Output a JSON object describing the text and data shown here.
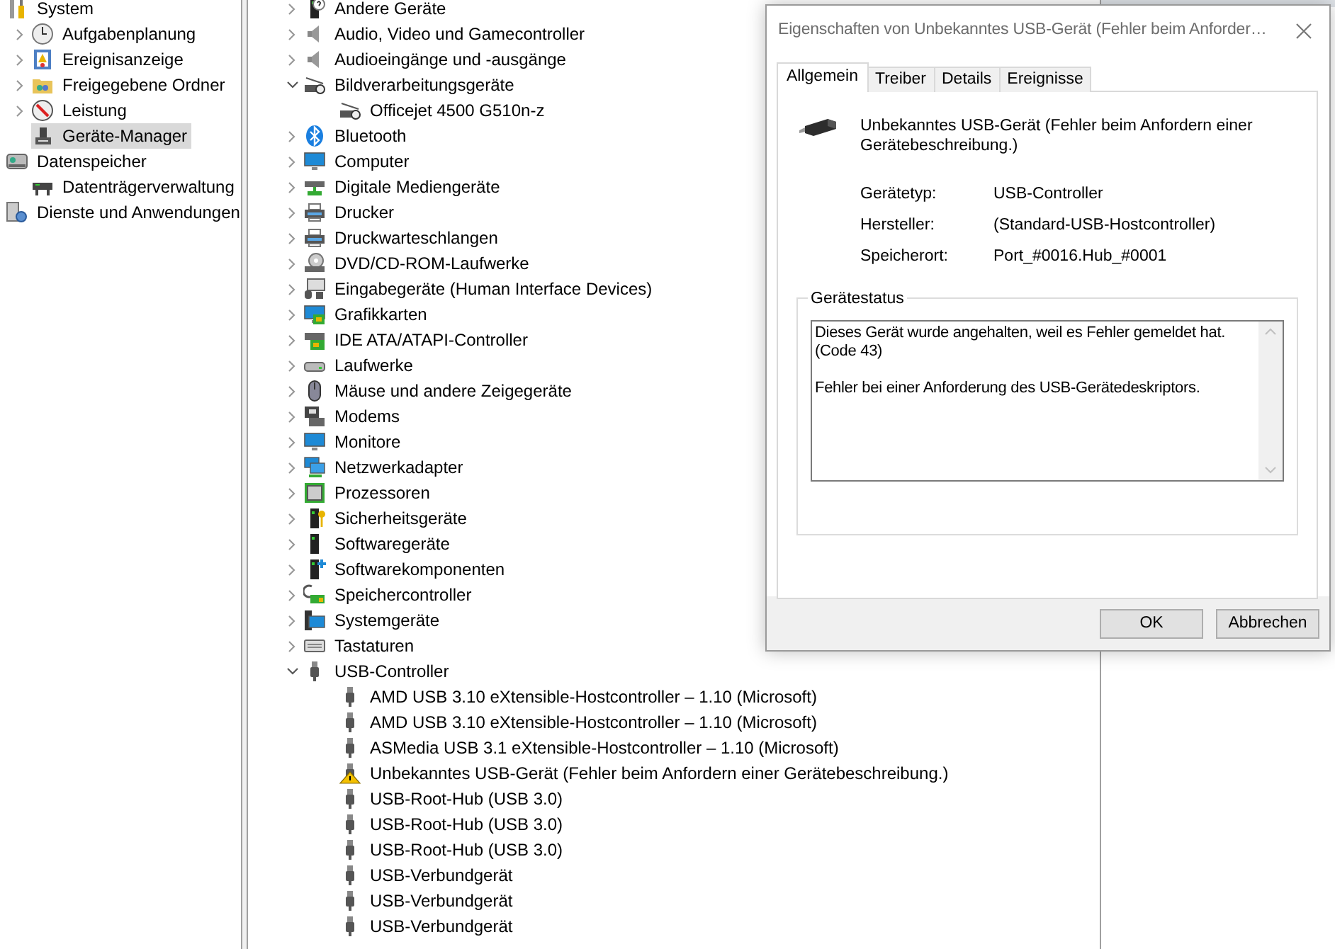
{
  "left_tree": [
    {
      "label": "System",
      "kind": "tools",
      "selected": false,
      "children": [
        {
          "label": "Aufgabenplanung",
          "kind": "clock",
          "expanded": false,
          "selected": false
        },
        {
          "label": "Ereignisanzeige",
          "kind": "event-log",
          "expanded": false,
          "selected": false
        },
        {
          "label": "Freigegebene Ordner",
          "kind": "shared-folder",
          "expanded": false,
          "selected": false
        },
        {
          "label": "Leistung",
          "kind": "performance",
          "expanded": false,
          "selected": false
        },
        {
          "label": "Geräte-Manager",
          "kind": "device-manager",
          "selected": true
        }
      ]
    },
    {
      "label": "Datenspeicher",
      "kind": "storage",
      "selected": false,
      "children": [
        {
          "label": "Datenträgerverwaltung",
          "kind": "disk",
          "selected": false
        }
      ]
    },
    {
      "label": "Dienste und Anwendungen",
      "kind": "services",
      "selected": false
    }
  ],
  "device_tree": [
    {
      "label": "Andere Geräte",
      "kind": "unknown",
      "expanded": false,
      "selected": false
    },
    {
      "label": "Audio, Video und Gamecontroller",
      "kind": "speaker",
      "expanded": false,
      "selected": false
    },
    {
      "label": "Audioeingänge und -ausgänge",
      "kind": "speaker",
      "expanded": false,
      "selected": false
    },
    {
      "label": "Bildverarbeitungsgeräte",
      "kind": "camera",
      "expanded": true,
      "selected": false,
      "children": [
        {
          "label": "Officejet 4500 G510n-z",
          "kind": "camera",
          "selected": false
        }
      ]
    },
    {
      "label": "Bluetooth",
      "kind": "bluetooth",
      "expanded": false,
      "selected": false
    },
    {
      "label": "Computer",
      "kind": "monitor",
      "expanded": false,
      "selected": false
    },
    {
      "label": "Digitale Mediengeräte",
      "kind": "media",
      "expanded": false,
      "selected": false
    },
    {
      "label": "Drucker",
      "kind": "printer",
      "expanded": false,
      "selected": false
    },
    {
      "label": "Druckwarteschlangen",
      "kind": "printer",
      "expanded": false,
      "selected": false
    },
    {
      "label": "DVD/CD-ROM-Laufwerke",
      "kind": "dvd",
      "expanded": false,
      "selected": false
    },
    {
      "label": "Eingabegeräte (Human Interface Devices)",
      "kind": "hid",
      "expanded": false,
      "selected": false
    },
    {
      "label": "Grafikkarten",
      "kind": "graphics",
      "expanded": false,
      "selected": false
    },
    {
      "label": "IDE ATA/ATAPI-Controller",
      "kind": "ide",
      "expanded": false,
      "selected": false
    },
    {
      "label": "Laufwerke",
      "kind": "drive",
      "expanded": false,
      "selected": false
    },
    {
      "label": "Mäuse und andere Zeigegeräte",
      "kind": "mouse",
      "expanded": false,
      "selected": false
    },
    {
      "label": "Modems",
      "kind": "modem",
      "expanded": false,
      "selected": false
    },
    {
      "label": "Monitore",
      "kind": "monitor",
      "expanded": false,
      "selected": false
    },
    {
      "label": "Netzwerkadapter",
      "kind": "network",
      "expanded": false,
      "selected": false
    },
    {
      "label": "Prozessoren",
      "kind": "processor",
      "expanded": false,
      "selected": false
    },
    {
      "label": "Sicherheitsgeräte",
      "kind": "security",
      "expanded": false,
      "selected": false
    },
    {
      "label": "Softwaregeräte",
      "kind": "tower",
      "expanded": false,
      "selected": false
    },
    {
      "label": "Softwarekomponenten",
      "kind": "component",
      "expanded": false,
      "selected": false
    },
    {
      "label": "Speichercontroller",
      "kind": "controller",
      "expanded": false,
      "selected": false
    },
    {
      "label": "Systemgeräte",
      "kind": "system",
      "expanded": false,
      "selected": false
    },
    {
      "label": "Tastaturen",
      "kind": "keyboard",
      "expanded": false,
      "selected": false
    },
    {
      "label": "USB-Controller",
      "kind": "usb",
      "expanded": true,
      "selected": false,
      "children": [
        {
          "label": "AMD USB 3.10 eXtensible-Hostcontroller – 1.10 (Microsoft)",
          "kind": "usb",
          "selected": false
        },
        {
          "label": "AMD USB 3.10 eXtensible-Hostcontroller – 1.10 (Microsoft)",
          "kind": "usb",
          "selected": false
        },
        {
          "label": "ASMedia USB 3.1 eXtensible-Hostcontroller – 1.10 (Microsoft)",
          "kind": "usb",
          "selected": false
        },
        {
          "label": "Unbekanntes USB-Gerät (Fehler beim Anfordern einer Gerätebeschreibung.)",
          "kind": "warning",
          "selected": false
        },
        {
          "label": "USB-Root-Hub (USB 3.0)",
          "kind": "usb",
          "selected": false
        },
        {
          "label": "USB-Root-Hub (USB 3.0)",
          "kind": "usb",
          "selected": false
        },
        {
          "label": "USB-Root-Hub (USB 3.0)",
          "kind": "usb",
          "selected": false
        },
        {
          "label": "USB-Verbundgerät",
          "kind": "usb",
          "selected": false
        },
        {
          "label": "USB-Verbundgerät",
          "kind": "usb",
          "selected": false
        },
        {
          "label": "USB-Verbundgerät",
          "kind": "usb",
          "selected": false
        }
      ]
    }
  ],
  "dialog": {
    "title": "Eigenschaften von Unbekanntes USB-Gerät (Fehler beim Anforder…",
    "tabs": [
      {
        "label": "Allgemein",
        "selected": true
      },
      {
        "label": "Treiber",
        "selected": false
      },
      {
        "label": "Details",
        "selected": false
      },
      {
        "label": "Ereignisse",
        "selected": false
      }
    ],
    "device_name": "Unbekanntes USB-Gerät (Fehler beim Anfordern einer Gerätebeschreibung.)",
    "properties": [
      {
        "label": "Gerätetyp:",
        "value": "USB-Controller"
      },
      {
        "label": "Hersteller:",
        "value": "(Standard-USB-Hostcontroller)"
      },
      {
        "label": "Speicherort:",
        "value": "Port_#0016.Hub_#0001"
      }
    ],
    "status_group": "Gerätestatus",
    "status_text": "Dieses Gerät wurde angehalten, weil es Fehler gemeldet hat.\n(Code 43)\n\nFehler bei einer Anforderung des USB-Gerätedeskriptors.",
    "buttons": [
      {
        "label": "OK"
      },
      {
        "label": "Abbrechen"
      }
    ]
  }
}
